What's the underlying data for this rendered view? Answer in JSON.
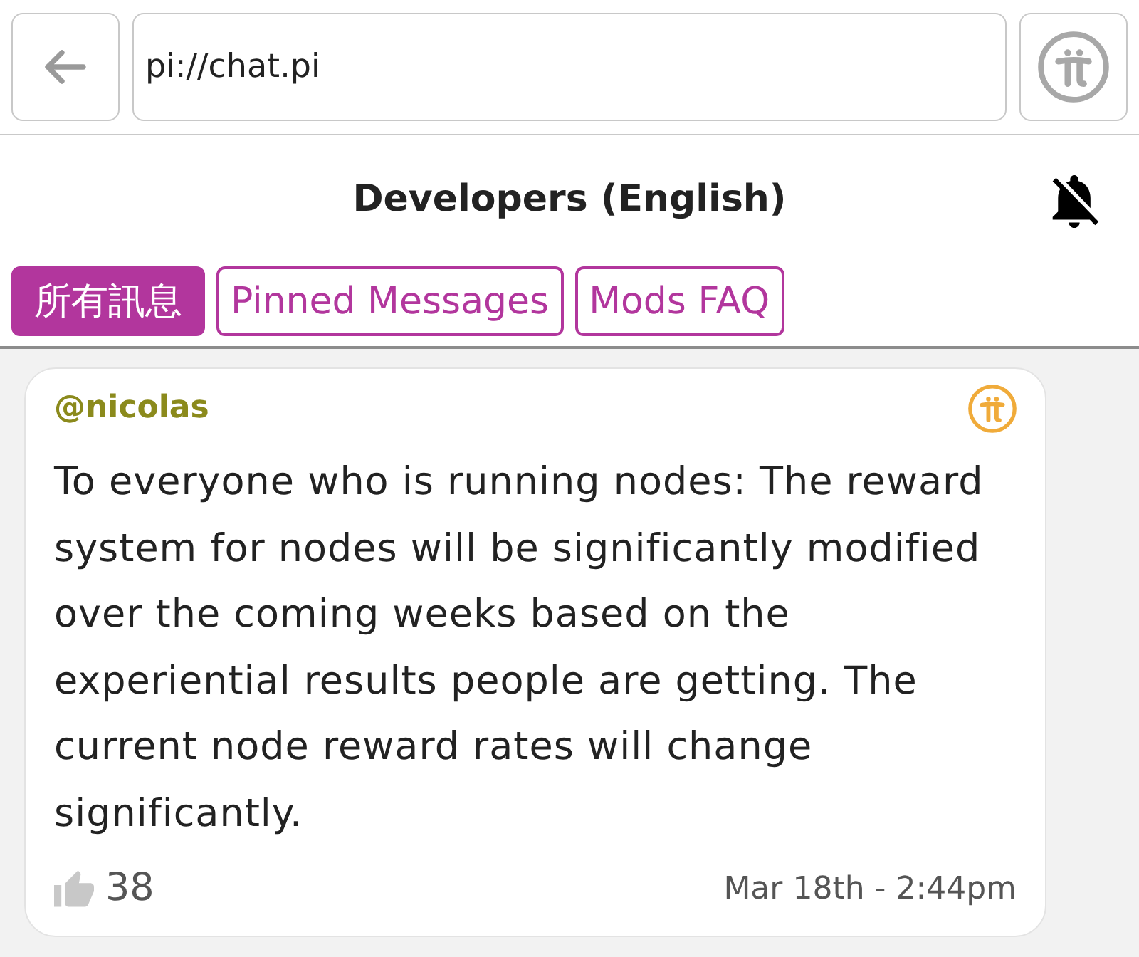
{
  "toolbar": {
    "address": "pi://chat.pi"
  },
  "channel": {
    "title": "Developers (English)",
    "notifications_muted": true
  },
  "tabs": [
    {
      "label": "所有訊息",
      "selected": true
    },
    {
      "label": "Pinned Messages",
      "selected": false
    },
    {
      "label": "Mods FAQ",
      "selected": false
    }
  ],
  "messages": [
    {
      "author": "@nicolas",
      "text": "To everyone who is running nodes: The reward system for nodes will be significantly modified over the coming weeks based on the experiential results people are getting. The current node reward rates will change significantly.",
      "likes": "38",
      "time": "Mar 18th - 2:44pm"
    }
  ]
}
